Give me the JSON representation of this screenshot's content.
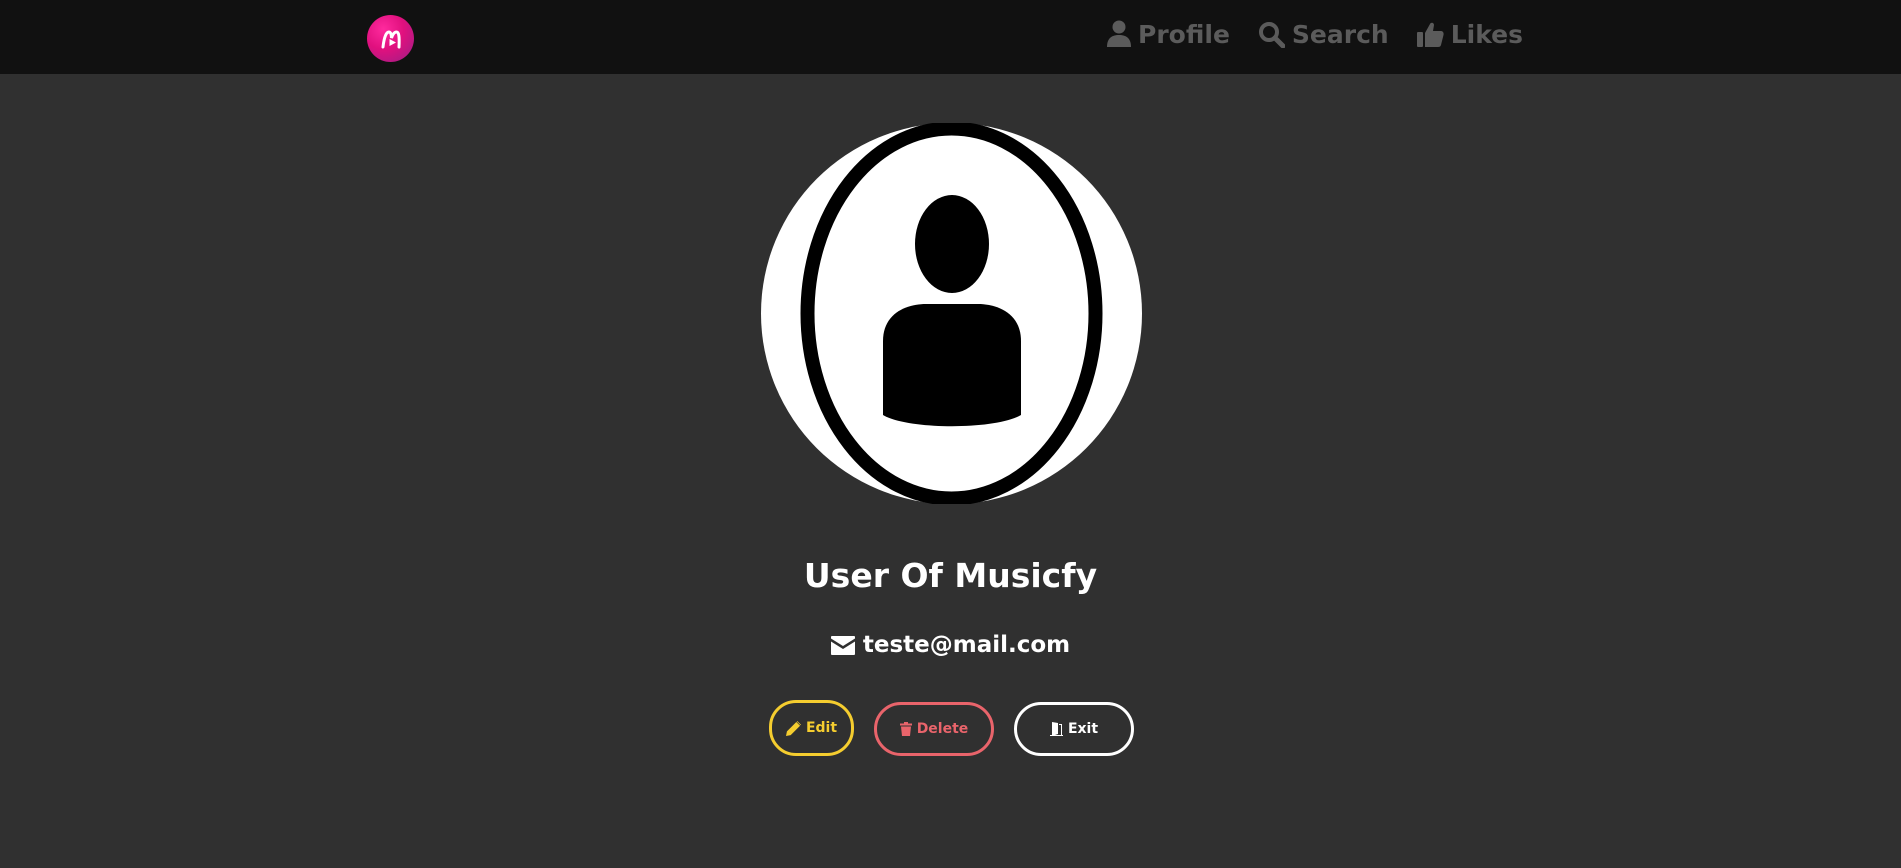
{
  "navbar": {
    "logo_icon": "musicfy-logo-icon",
    "links": [
      {
        "label": "Profile",
        "icon": "user-icon"
      },
      {
        "label": "Search",
        "icon": "search-icon"
      },
      {
        "label": "Likes",
        "icon": "thumbs-up-icon"
      }
    ]
  },
  "profile": {
    "avatar_icon": "user-avatar-icon",
    "name": "User Of Musicfy",
    "email": "teste@mail.com",
    "email_icon": "envelope-icon"
  },
  "actions": {
    "edit_label": "Edit",
    "delete_label": "Delete",
    "exit_label": "Exit"
  },
  "colors": {
    "background": "#303030",
    "navbar": "#111111",
    "nav_link": "#5b5b5b",
    "edit": "#f5cd2f",
    "delete": "#e9646b",
    "exit": "#ffffff",
    "logo": "#e0107e"
  }
}
